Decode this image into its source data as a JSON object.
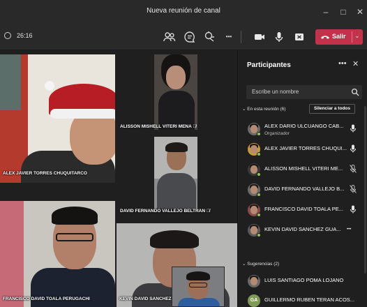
{
  "window": {
    "title": "Nueva reunión de canal",
    "minimize_glyph": "–",
    "maximize_glyph": "□",
    "close_glyph": "✕"
  },
  "toolbar": {
    "timer": "26:16",
    "more_glyph": "•••",
    "leave_label": "Salir",
    "leave_chevron": "⌄",
    "accent": "#c4314b"
  },
  "videos": [
    {
      "name": "ALEX JAVIER TORRES CHUQUITARCO",
      "muted": false
    },
    {
      "name": "ALISSON MISHELL VITERI MENA",
      "muted": true
    },
    {
      "name": "DAVID FERNANDO VALLEJO BELTRAN",
      "muted": true
    },
    {
      "name": "FRANCISCO DAVID TOALA PERUGACHI",
      "muted": false
    },
    {
      "name": "KEVIN DAVID SANCHEZ",
      "muted": false
    }
  ],
  "mute_glyph": "🎙̸",
  "panel": {
    "title": "Participantes",
    "more_glyph": "•••",
    "close_glyph": "✕",
    "search_placeholder": "Escribe un nombre",
    "in_meeting_label": "En esta reunión (6)",
    "in_meeting_chevron": "⌄",
    "mute_all_label": "Silenciar a todos",
    "suggestions_label": "Sugerencias (2)",
    "suggestions_chevron": "⌄",
    "participants": [
      {
        "name": "ALEX DARIO ULCUANGO CAB...",
        "role": "Organizador",
        "mic": "on"
      },
      {
        "name": "ALEX JAVIER TORRES CHUQUI...",
        "role": "",
        "mic": "on"
      },
      {
        "name": "ALISSON MISHELL VITERI ME...",
        "role": "",
        "mic": "muted"
      },
      {
        "name": "DAVID FERNANDO VALLEJO B...",
        "role": "",
        "mic": "muted"
      },
      {
        "name": "FRANCISCO DAVID TOALA PE...",
        "role": "",
        "mic": "on"
      },
      {
        "name": "KEVIN DAVID SANCHEZ GUA...",
        "role": "",
        "mic": "more"
      }
    ],
    "suggestions": [
      {
        "name": "LUIS SANTIAGO POMA LOJANO",
        "initials": ""
      },
      {
        "name": "GUILLERMO RUBEN TERAN ACOS...",
        "initials": "GA"
      }
    ],
    "more_glyph_row": "•••",
    "status_color": "#92c353"
  }
}
